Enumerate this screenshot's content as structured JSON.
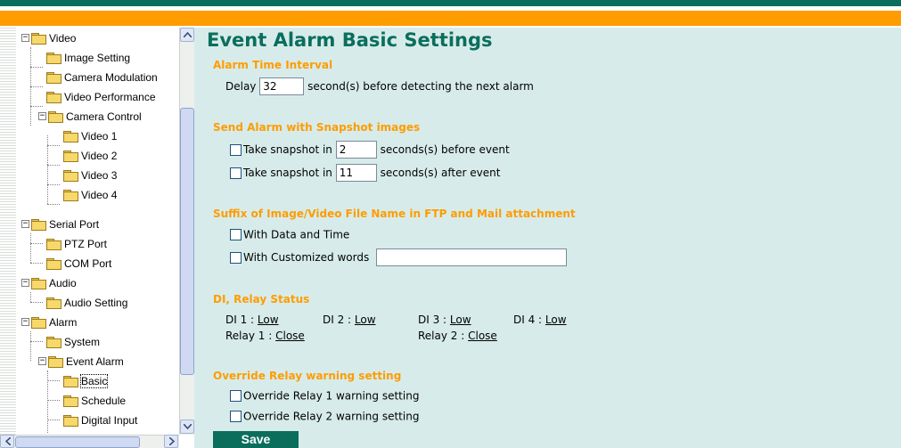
{
  "sidebar": {
    "items": [
      {
        "label": "Video",
        "expander": "−"
      },
      {
        "label": "Image Setting"
      },
      {
        "label": "Camera Modulation"
      },
      {
        "label": "Video Performance"
      },
      {
        "label": "Camera Control",
        "expander": "−"
      },
      {
        "label": "Video 1"
      },
      {
        "label": "Video 2"
      },
      {
        "label": "Video 3"
      },
      {
        "label": "Video 4"
      },
      {
        "label": "Serial Port",
        "expander": "−"
      },
      {
        "label": "PTZ Port"
      },
      {
        "label": "COM Port"
      },
      {
        "label": "Audio",
        "expander": "−"
      },
      {
        "label": "Audio Setting"
      },
      {
        "label": "Alarm",
        "expander": "−"
      },
      {
        "label": "System"
      },
      {
        "label": "Event Alarm",
        "expander": "−"
      },
      {
        "label": "Basic",
        "selected": true
      },
      {
        "label": "Schedule"
      },
      {
        "label": "Digital Input"
      }
    ]
  },
  "main": {
    "title": "Event Alarm Basic Settings",
    "alarm_time": {
      "heading": "Alarm Time Interval",
      "delay_label": "Delay",
      "delay_value": "32",
      "delay_suffix": "second(s) before detecting the next alarm"
    },
    "snapshot": {
      "heading": "Send Alarm with Snapshot images",
      "before_label": "Take snapshot in",
      "before_value": "2",
      "before_suffix": "seconds(s) before event",
      "after_label": "Take snapshot in",
      "after_value": "11",
      "after_suffix": "seconds(s) after event"
    },
    "suffix": {
      "heading": "Suffix of Image/Video File Name in FTP and Mail attachment",
      "date_time_label": "With Data and Time",
      "custom_label": "With Customized words",
      "custom_value": ""
    },
    "di_relay": {
      "heading": "DI, Relay Status",
      "di": [
        {
          "label": "DI 1 :",
          "value": "Low"
        },
        {
          "label": "DI 2 :",
          "value": "Low"
        },
        {
          "label": "DI 3 :",
          "value": "Low"
        },
        {
          "label": "DI 4 :",
          "value": "Low"
        }
      ],
      "relays": [
        {
          "label": "Relay 1 :",
          "value": "Close"
        },
        {
          "label": "Relay 2 :",
          "value": "Close"
        }
      ]
    },
    "override": {
      "heading": "Override Relay warning setting",
      "relay1_label": "Override Relay 1 warning setting",
      "relay2_label": "Override Relay 2 warning setting"
    },
    "save_label": "Save"
  },
  "colors": {
    "header_green": "#0b6e5d",
    "header_orange": "#ff9c00",
    "content_bg": "#d7ecea",
    "section_heading": "#ff9c00"
  }
}
